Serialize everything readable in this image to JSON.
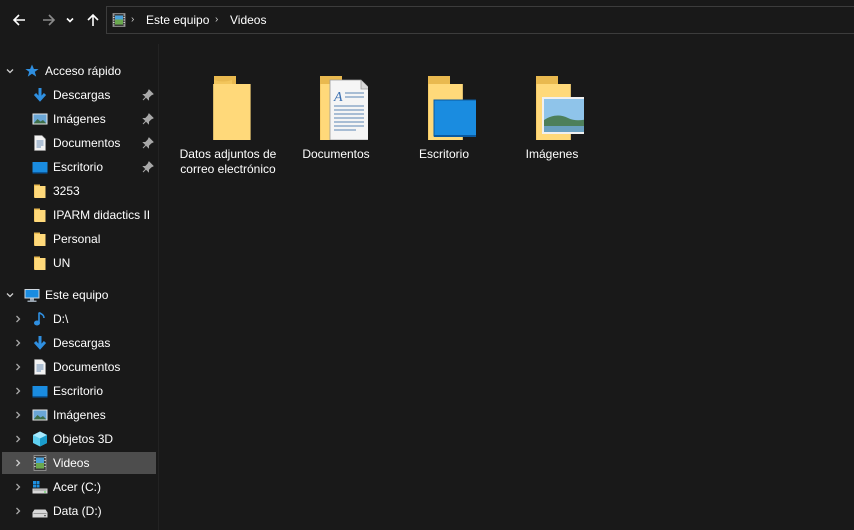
{
  "address_bar": {
    "crumbs": [
      "Este equipo",
      "Videos"
    ]
  },
  "navigation": {
    "back_icon": "arrow-left-icon",
    "forward_icon": "arrow-right-icon",
    "recent_icon": "chevron-down-icon",
    "up_icon": "arrow-up-icon"
  },
  "sidebar": {
    "quick_access": {
      "label": "Acceso rápido",
      "items": [
        {
          "label": "Descargas",
          "icon": "download-arrow-icon",
          "pinned": true
        },
        {
          "label": "Imágenes",
          "icon": "pictures-icon",
          "pinned": true
        },
        {
          "label": "Documentos",
          "icon": "document-icon",
          "pinned": true
        },
        {
          "label": "Escritorio",
          "icon": "desktop-icon",
          "pinned": true
        },
        {
          "label": "3253",
          "icon": "folder-icon",
          "pinned": false
        },
        {
          "label": "IPARM didactics II",
          "icon": "folder-icon",
          "pinned": false
        },
        {
          "label": "Personal",
          "icon": "folder-icon",
          "pinned": false
        },
        {
          "label": "UN",
          "icon": "folder-icon",
          "pinned": false
        }
      ]
    },
    "this_pc": {
      "label": "Este equipo",
      "items": [
        {
          "label": "D:\\",
          "icon": "music-note-icon"
        },
        {
          "label": "Descargas",
          "icon": "download-arrow-icon"
        },
        {
          "label": "Documentos",
          "icon": "document-icon"
        },
        {
          "label": "Escritorio",
          "icon": "desktop-icon"
        },
        {
          "label": "Imágenes",
          "icon": "pictures-icon"
        },
        {
          "label": "Objetos 3D",
          "icon": "cube-3d-icon"
        },
        {
          "label": "Videos",
          "icon": "video-icon",
          "selected": true
        },
        {
          "label": "Acer (C:)",
          "icon": "os-drive-icon"
        },
        {
          "label": "Data (D:)",
          "icon": "drive-icon"
        }
      ]
    }
  },
  "content": {
    "items": [
      {
        "label": "Datos adjuntos de correo electrónico",
        "icon": "folder-icon"
      },
      {
        "label": "Documentos",
        "icon": "folder-documents-icon"
      },
      {
        "label": "Escritorio",
        "icon": "folder-desktop-icon"
      },
      {
        "label": "Imágenes",
        "icon": "folder-pictures-icon"
      }
    ]
  },
  "colors": {
    "background": "#191919",
    "selected_row": "#4d4d4d",
    "folder_yellow": "#ffd97a",
    "accent_blue": "#1e90e0"
  }
}
